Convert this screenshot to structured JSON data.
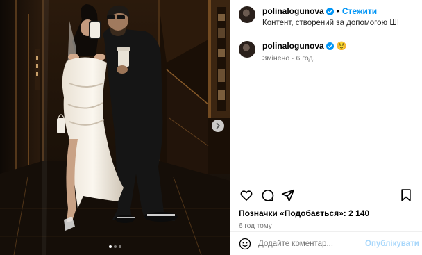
{
  "header": {
    "username": "polinalogunova",
    "separator": "•",
    "follow_label": "Стежити",
    "subtitle": "Контент, створений за допомогою ШІ"
  },
  "comment": {
    "username": "polinalogunova",
    "emoji": "☺️",
    "meta": "Змінено · 6 год."
  },
  "likes": "Позначки «Подобається»: 2 140",
  "time_ago": "6 год тому",
  "add_comment": {
    "placeholder": "Додайте коментар...",
    "publish_label": "Опублікувати"
  },
  "carousel": {
    "slides": 3,
    "active": 1
  },
  "icons": [
    "verified-icon",
    "heart-icon",
    "comment-icon",
    "share-icon",
    "bookmark-icon",
    "emoji-icon",
    "chevron-right-icon"
  ],
  "colors": {
    "accent": "#0095f6",
    "muted": "#737373",
    "verified": "#0095f6",
    "publish_disabled": "#a8d7fb"
  }
}
